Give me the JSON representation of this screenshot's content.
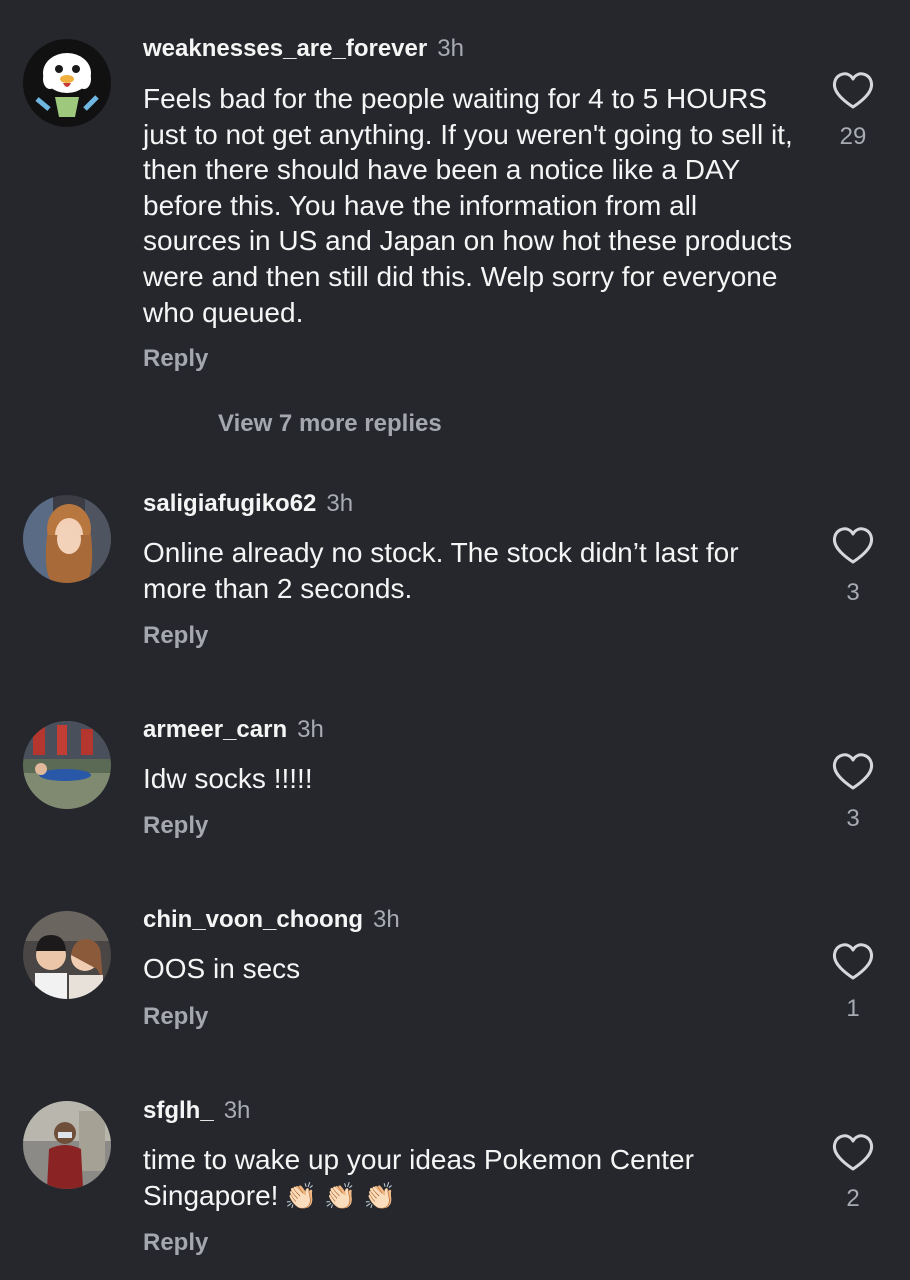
{
  "comments": [
    {
      "username": "weaknesses_are_forever",
      "time": "3h",
      "text": "Feels bad for the people waiting for 4 to 5 HOURS just to not get anything. If you weren't going to sell it, then there should have been a notice like a DAY before this. You have the information from all sources in US and Japan on how hot these products were and then still did this. Welp sorry for everyone who queued.",
      "likes": "29",
      "reply_label": "Reply",
      "avatar": "oshawott-avatar"
    },
    {
      "username": "saligiafugiko62",
      "time": "3h",
      "text": "Online already no stock. The stock didn’t last for more than 2 seconds.",
      "likes": "3",
      "reply_label": "Reply",
      "avatar": "photo-avatar"
    },
    {
      "username": "armeer_carn",
      "time": "3h",
      "text": "Idw socks !!!!!",
      "likes": "3",
      "reply_label": "Reply",
      "avatar": "photo-avatar"
    },
    {
      "username": "chin_voon_choong",
      "time": "3h",
      "text": "OOS in secs",
      "likes": "1",
      "reply_label": "Reply",
      "avatar": "photo-avatar"
    },
    {
      "username": "sfglh_",
      "time": "3h",
      "text": "time to wake up your ideas Pokemon Center Singapore!",
      "emoji": "👏🏻 👏🏻 👏🏻",
      "likes": "2",
      "reply_label": "Reply",
      "avatar": "photo-avatar"
    }
  ],
  "view_more_replies": "View 7 more replies",
  "icons": {
    "like": "heart-outline-icon"
  },
  "colors": {
    "background": "#25272d",
    "text": "#f5f5f5",
    "muted": "#a8abb1"
  }
}
